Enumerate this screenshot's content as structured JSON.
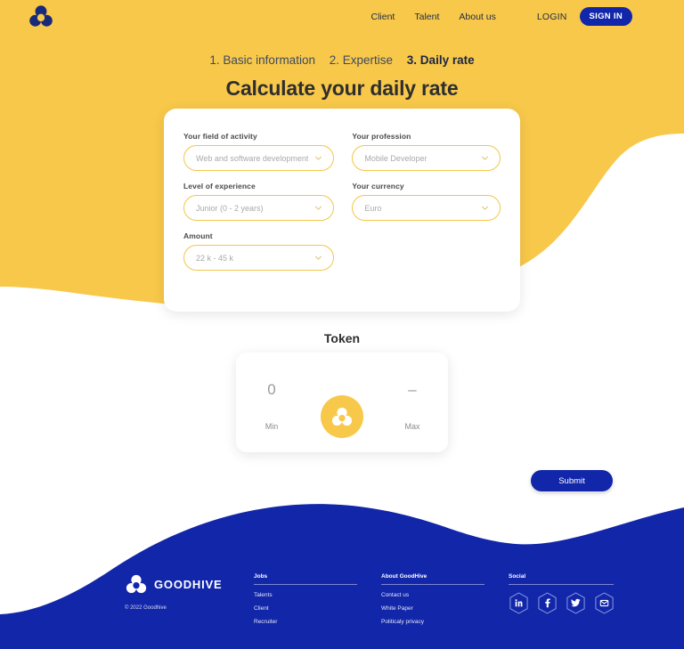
{
  "colors": {
    "yellow": "#f8c84a",
    "blue": "#1226aa",
    "blue_dark": "#16249e",
    "navy_text": "#1d2b4b",
    "field_border": "#f3c64a",
    "placeholder": "#a9a9a9"
  },
  "header": {
    "logo_icon": "goodhive-trefoil-logo-icon",
    "nav": [
      {
        "label": "Client"
      },
      {
        "label": "Talent"
      },
      {
        "label": "About us"
      }
    ],
    "login_label": "LOGIN",
    "signin_label": "SIGN IN"
  },
  "steps": [
    {
      "label": "1. Basic information",
      "active": false
    },
    {
      "label": "2. Expertise",
      "active": false
    },
    {
      "label": "3. Daily rate",
      "active": true
    }
  ],
  "title": "Calculate your daily rate",
  "form": {
    "fields": [
      {
        "label": "Your field of activity",
        "value": "Web and software development",
        "name": "field-of-activity"
      },
      {
        "label": "Your profession",
        "value": "Mobile Developer",
        "name": "profession"
      },
      {
        "label": "Level of experience",
        "value": "Junior (0 - 2 years)",
        "name": "level-of-experience"
      },
      {
        "label": "Your currency",
        "value": "Euro",
        "name": "currency"
      },
      {
        "label": "Amount",
        "value": "22 k - 45 k",
        "name": "amount"
      }
    ]
  },
  "token": {
    "title": "Token",
    "min_value": "0",
    "min_label": "Min",
    "max_value": "–",
    "max_label": "Max",
    "badge_icon": "goodhive-trefoil-logo-icon"
  },
  "submit_label": "Submit",
  "footer": {
    "brand": "GOODHIVE",
    "copyright": "© 2022 Goodhive",
    "columns": [
      {
        "heading": "Jobs",
        "links": [
          {
            "label": "Talents"
          },
          {
            "label": "Client"
          },
          {
            "label": "Recruiter"
          }
        ]
      },
      {
        "heading": "About GoodHive",
        "links": [
          {
            "label": "Contact us"
          },
          {
            "label": "White Paper"
          },
          {
            "label": "Politicaly privacy"
          }
        ]
      }
    ],
    "social": {
      "heading": "Social",
      "icons": [
        {
          "name": "linkedin-icon"
        },
        {
          "name": "facebook-icon"
        },
        {
          "name": "twitter-icon"
        },
        {
          "name": "email-icon"
        }
      ]
    }
  }
}
